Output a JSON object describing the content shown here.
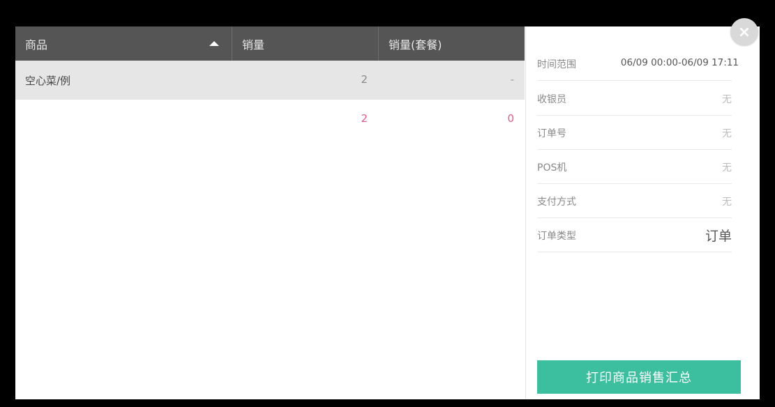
{
  "table": {
    "headers": {
      "product": "商品",
      "qty": "销量",
      "qty_combo": "销量(套餐)"
    },
    "rows": [
      {
        "name": "空心菜/例",
        "qty": "2",
        "qty_combo": "-"
      }
    ],
    "total": {
      "qty": "2",
      "qty_combo": "0"
    }
  },
  "info": {
    "time_range": {
      "label": "时间范围",
      "value": "06/09 00:00-06/09 17:11"
    },
    "cashier": {
      "label": "收银员",
      "value": "无"
    },
    "order_no": {
      "label": "订单号",
      "value": "无"
    },
    "pos": {
      "label": "POS机",
      "value": "无"
    },
    "pay_method": {
      "label": "支付方式",
      "value": "无"
    },
    "order_type": {
      "label": "订单类型",
      "value": "订单"
    }
  },
  "print_button": "打印商品销售汇总",
  "close": "×",
  "colors": {
    "accent": "#3cbf9f",
    "highlight": "#e2598b",
    "header_bg": "#555555"
  }
}
